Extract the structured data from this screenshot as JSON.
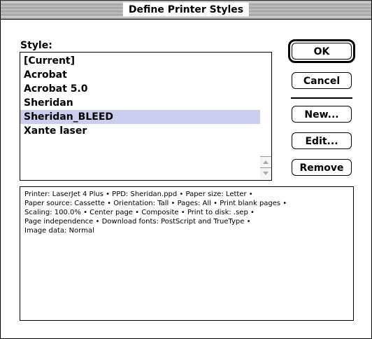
{
  "window": {
    "title": "Define Printer Styles"
  },
  "style_list": {
    "label": "Style:",
    "items": [
      {
        "label": "[Current]",
        "selected": false
      },
      {
        "label": "Acrobat",
        "selected": false
      },
      {
        "label": "Acrobat 5.0",
        "selected": false
      },
      {
        "label": "Sheridan",
        "selected": false
      },
      {
        "label": "Sheridan_BLEED",
        "selected": true
      },
      {
        "label": "Xante laser",
        "selected": false
      }
    ]
  },
  "buttons": {
    "ok": "OK",
    "cancel": "Cancel",
    "new": "New...",
    "edit": "Edit...",
    "remove": "Remove"
  },
  "description": {
    "lines": [
      "Printer: LaserJet 4 Plus • PPD: Sheridan.ppd • Paper size: Letter •",
      "Paper source: Cassette • Orientation: Tall • Pages: All • Print blank pages •",
      "Scaling: 100.0% • Center page • Composite • Print to disk: .sep •",
      "Page independence • Download fonts: PostScript and TrueType •",
      "Image data: Normal"
    ]
  },
  "colors": {
    "selection": "#ccccee",
    "border": "#000000",
    "background": "#ffffff"
  }
}
